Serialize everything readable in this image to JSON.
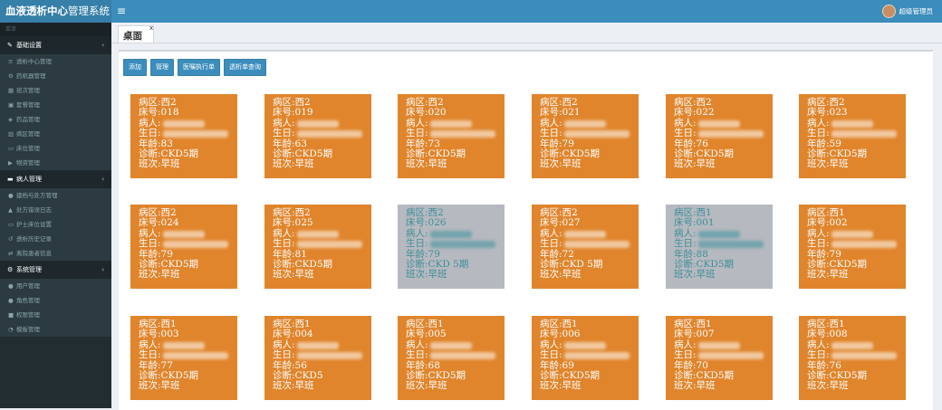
{
  "app": {
    "title_bold": "血液透析中心",
    "title_rest": "管理系统",
    "menu_toggle": "≡"
  },
  "user": {
    "name": "超级管理员"
  },
  "sidebar": {
    "header": "菜单",
    "groups": [
      {
        "label": "基础设置",
        "icon": "edit-icon",
        "glyph": "✎",
        "chevron": "‹",
        "items": [
          {
            "label": "透析中心管理",
            "icon": "list-icon",
            "glyph": "≡"
          },
          {
            "label": "药机器管理",
            "icon": "gear-icon",
            "glyph": "⚙"
          },
          {
            "label": "班次管理",
            "icon": "calendar-icon",
            "glyph": "▦"
          },
          {
            "label": "套餐管理",
            "icon": "box-icon",
            "glyph": "▣"
          },
          {
            "label": "药品管理",
            "icon": "pill-icon",
            "glyph": "◈"
          },
          {
            "label": "病区管理",
            "icon": "building-icon",
            "glyph": "▥"
          },
          {
            "label": "床位管理",
            "icon": "bed-icon",
            "glyph": "▭"
          },
          {
            "label": "物资管理",
            "icon": "truck-icon",
            "glyph": "▶"
          }
        ]
      },
      {
        "label": "病人管理",
        "icon": "id-card-icon",
        "glyph": "▬",
        "chevron": "‹",
        "items": [
          {
            "label": "建档与处方管理",
            "icon": "user-icon",
            "glyph": "●"
          },
          {
            "label": "处方错误日志",
            "icon": "warning-icon",
            "glyph": "▲"
          },
          {
            "label": "护士床位设置",
            "icon": "bed-icon",
            "glyph": "▭"
          },
          {
            "label": "透析历史记录",
            "icon": "history-icon",
            "glyph": "↺"
          },
          {
            "label": "离院患者信息",
            "icon": "transfer-icon",
            "glyph": "⇄"
          }
        ]
      },
      {
        "label": "系统管理",
        "icon": "gear-icon",
        "glyph": "⚙",
        "chevron": "‹",
        "items": [
          {
            "label": "用户管理",
            "icon": "user-icon",
            "glyph": "●"
          },
          {
            "label": "角色管理",
            "icon": "users-icon",
            "glyph": "●"
          },
          {
            "label": "权限管理",
            "icon": "lock-icon",
            "glyph": "■"
          },
          {
            "label": "模板管理",
            "icon": "dashboard-icon",
            "glyph": "◔"
          }
        ]
      }
    ]
  },
  "tabs": [
    {
      "label": "桌面",
      "close": "x"
    }
  ],
  "toolbar": {
    "buttons": [
      "添加",
      "管理",
      "医嘱执行单",
      "透析单查询"
    ]
  },
  "labels": {
    "ward": "病区",
    "bed": "床号",
    "patient": "病人",
    "birth": "生日",
    "age": "年龄",
    "diagnosis": "诊断",
    "shift": "班次"
  },
  "cards": [
    {
      "ward": "西2",
      "bed": "018",
      "age": "83",
      "diagnosis": "CKD5期",
      "shift": "早班",
      "status": "active"
    },
    {
      "ward": "西2",
      "bed": "019",
      "age": "63",
      "diagnosis": "CKD5期",
      "shift": "早班",
      "status": "active"
    },
    {
      "ward": "西2",
      "bed": "020",
      "age": "73",
      "diagnosis": "CKD5期",
      "shift": "早班",
      "status": "active"
    },
    {
      "ward": "西2",
      "bed": "021",
      "age": "79",
      "diagnosis": "CKD5期",
      "shift": "早班",
      "status": "active"
    },
    {
      "ward": "西2",
      "bed": "022",
      "age": "76",
      "diagnosis": "CKD5期",
      "shift": "早班",
      "status": "active"
    },
    {
      "ward": "西2",
      "bed": "023",
      "age": "59",
      "diagnosis": "CKD5期",
      "shift": "早班",
      "status": "active"
    },
    {
      "ward": "西2",
      "bed": "024",
      "age": "79",
      "diagnosis": "CKD5期",
      "shift": "早班",
      "status": "active"
    },
    {
      "ward": "西2",
      "bed": "025",
      "age": "81",
      "diagnosis": "CKD5期",
      "shift": "早班",
      "status": "active"
    },
    {
      "ward": "西2",
      "bed": "026",
      "age": "79",
      "diagnosis": "CKD 5期",
      "shift": "早班",
      "status": "inactive"
    },
    {
      "ward": "西2",
      "bed": "027",
      "age": "72",
      "diagnosis": "CKD 5期",
      "shift": "早班",
      "status": "active"
    },
    {
      "ward": "西1",
      "bed": "001",
      "age": "88",
      "diagnosis": "CKD5期",
      "shift": "早班",
      "status": "inactive"
    },
    {
      "ward": "西1",
      "bed": "002",
      "age": "79",
      "diagnosis": "CKD5期",
      "shift": "早班",
      "status": "active"
    },
    {
      "ward": "西1",
      "bed": "003",
      "age": "77",
      "diagnosis": "CKD5期",
      "shift": "早班",
      "status": "active"
    },
    {
      "ward": "西1",
      "bed": "004",
      "age": "56",
      "diagnosis": "CKD5",
      "shift": "早班",
      "status": "active"
    },
    {
      "ward": "西1",
      "bed": "005",
      "age": "68",
      "diagnosis": "CKD5期",
      "shift": "早班",
      "status": "active"
    },
    {
      "ward": "西1",
      "bed": "006",
      "age": "69",
      "diagnosis": "CKD5期",
      "shift": "早班",
      "status": "active"
    },
    {
      "ward": "西1",
      "bed": "007",
      "age": "70",
      "diagnosis": "CKD5期",
      "shift": "早班",
      "status": "active"
    },
    {
      "ward": "西1",
      "bed": "008",
      "age": "76",
      "diagnosis": "CKD5期",
      "shift": "早班",
      "status": "active"
    }
  ]
}
